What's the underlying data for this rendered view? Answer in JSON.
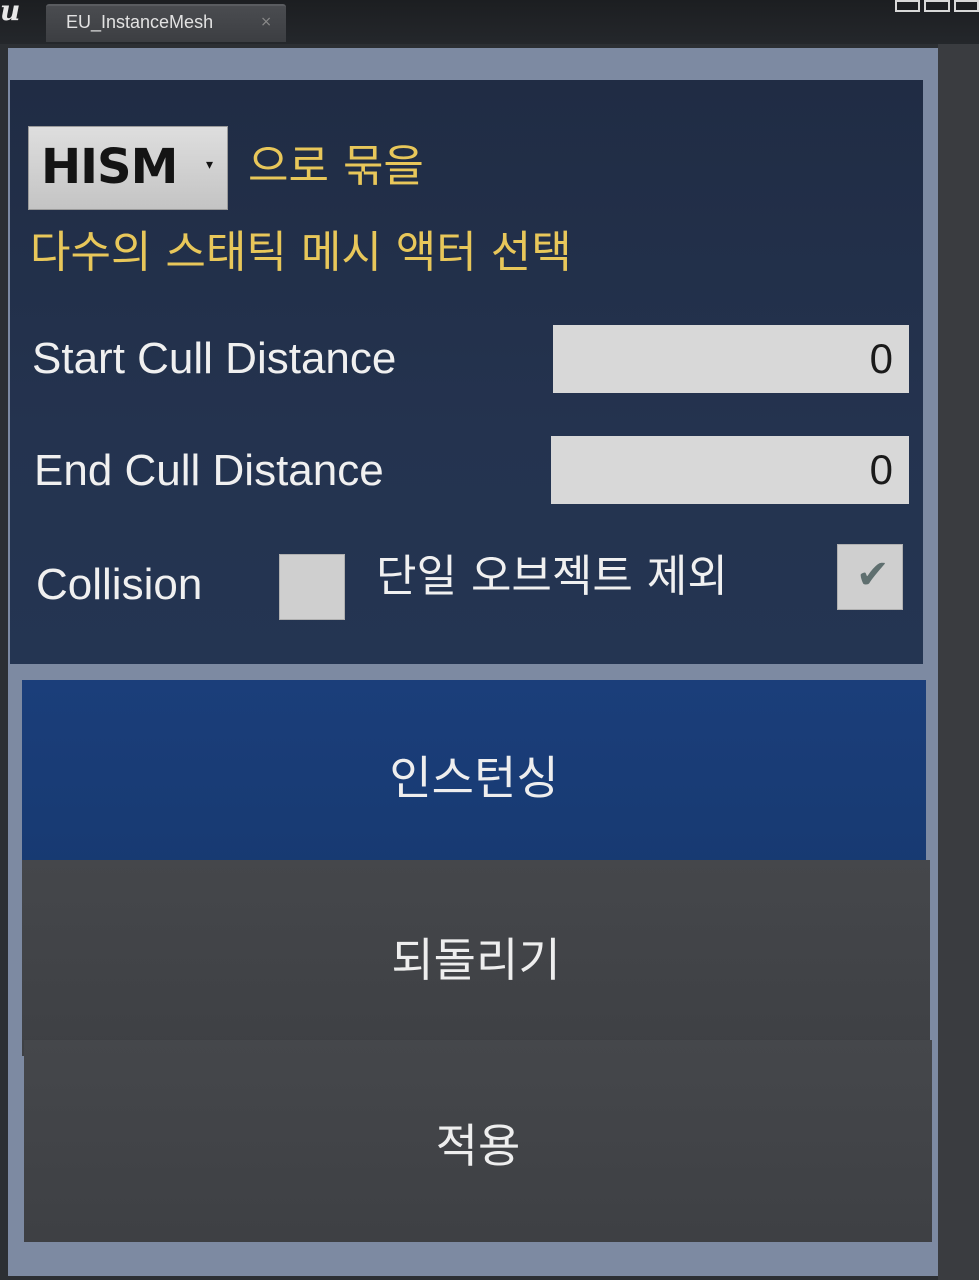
{
  "window": {
    "tab_title": "EU_InstanceMesh",
    "tab_close": "×",
    "logo_glyph": "u"
  },
  "form": {
    "group_type": {
      "selected": "HISM",
      "arrow": "▾",
      "suffix_text": "으로 묶을"
    },
    "instruction": "다수의 스태틱 메시 액터 선택",
    "start_cull": {
      "label": "Start Cull Distance",
      "value": "0"
    },
    "end_cull": {
      "label": "End Cull Distance",
      "value": "0"
    },
    "collision": {
      "label": "Collision",
      "checked": false
    },
    "exclude_single": {
      "label": "단일 오브젝트 제외",
      "checked": true,
      "mark": "✔"
    }
  },
  "buttons": {
    "instancing": "인스턴싱",
    "revert": "되돌리기",
    "apply": "적용"
  },
  "colors": {
    "accent_yellow": "#e8c75a",
    "panel_blue": "#202c44",
    "primary_button": "#1b3e7a",
    "secondary_button": "#45474b"
  }
}
